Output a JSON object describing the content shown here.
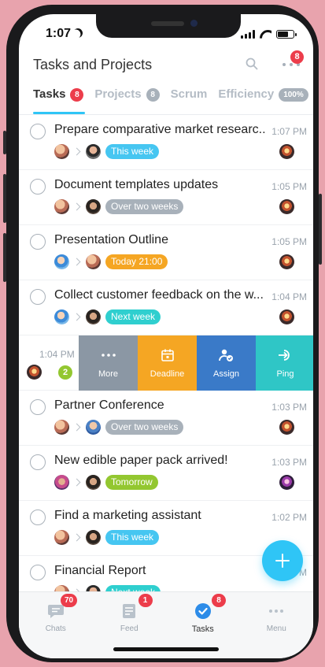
{
  "status": {
    "time": "1:07"
  },
  "header": {
    "title": "Tasks and Projects",
    "notifications_badge": "8"
  },
  "tabs": [
    {
      "label": "Tasks",
      "badge": "8"
    },
    {
      "label": "Projects",
      "badge": "8"
    },
    {
      "label": "Scrum"
    },
    {
      "label": "Efficiency",
      "badge": "100%"
    }
  ],
  "tasks": [
    {
      "title": "Prepare comparative market researc...",
      "time": "1:07 PM",
      "deadline": "This week"
    },
    {
      "title": "Document templates updates",
      "time": "1:05 PM",
      "deadline": "Over two weeks"
    },
    {
      "title": "Presentation Outline",
      "time": "1:05 PM",
      "deadline": "Today 21:00"
    },
    {
      "title": "Collect customer feedback on the w...",
      "time": "1:04 PM",
      "deadline": "Next week"
    },
    {
      "title": "Partner Conference",
      "time": "1:03 PM",
      "deadline": "Over two weeks"
    },
    {
      "title": "New edible paper pack arrived!",
      "time": "1:03 PM",
      "deadline": "Tomorrow"
    },
    {
      "title": "Find a marketing assistant",
      "time": "1:02 PM",
      "deadline": "This week"
    },
    {
      "title": "Financial Report",
      "time": "PM",
      "deadline": "Next week"
    }
  ],
  "swipe_row": {
    "time": "1:04 PM",
    "count": "2",
    "actions": {
      "more": "More",
      "deadline": "Deadline",
      "assign": "Assign",
      "ping": "Ping"
    }
  },
  "nav": [
    {
      "label": "Chats",
      "badge": "70"
    },
    {
      "label": "Feed",
      "badge": "1"
    },
    {
      "label": "Tasks",
      "badge": "8"
    },
    {
      "label": "Menu"
    }
  ],
  "colors": {
    "accent": "#2fc5f6",
    "badge_red": "#ec3d4b",
    "deadline_blue": "#46c6f1",
    "deadline_grey": "#a8b1ba",
    "deadline_orange": "#f5a623",
    "deadline_teal": "#2fcfcf",
    "deadline_green": "#93c730",
    "action_more": "#8b97a4",
    "action_deadline": "#f5a623",
    "action_assign": "#3a7ac8",
    "action_ping": "#2fc6c6",
    "background": "#e8a3ad"
  },
  "icons": [
    "search-icon",
    "more-icon",
    "moon-icon",
    "signal-icon",
    "wifi-icon",
    "battery-icon",
    "chats-icon",
    "feed-icon",
    "tasks-check-icon",
    "menu-icon",
    "calendar-icon",
    "assign-icon",
    "ping-icon",
    "plus-icon"
  ]
}
